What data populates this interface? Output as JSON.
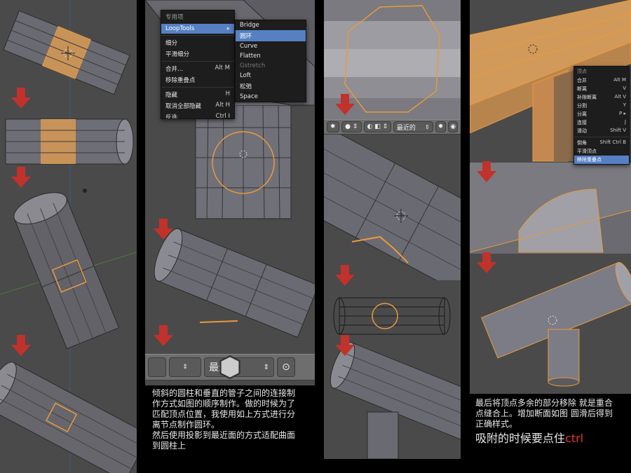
{
  "panel2": {
    "menu_main": {
      "title": "专用项",
      "items": [
        {
          "label": "LoopTools",
          "shortcut": "▸",
          "selected": true
        },
        {
          "label": "细分",
          "shortcut": ""
        },
        {
          "label": "平滑细分",
          "shortcut": ""
        },
        {
          "label": "合并...",
          "shortcut": "Alt M"
        },
        {
          "label": "移除重叠点",
          "shortcut": ""
        },
        {
          "label": "隐藏",
          "shortcut": "H"
        },
        {
          "label": "取消全部隐藏",
          "shortcut": "Alt H"
        },
        {
          "label": "反选",
          "shortcut": "Ctrl I"
        }
      ]
    },
    "menu_sub": {
      "items": [
        {
          "label": "Bridge",
          "state": ""
        },
        {
          "label": "圆环",
          "state": "selected"
        },
        {
          "label": "Curve",
          "state": ""
        },
        {
          "label": "Flatten",
          "state": ""
        },
        {
          "label": "Gstretch",
          "state": "disabled"
        },
        {
          "label": "Loft",
          "state": ""
        },
        {
          "label": "松弛",
          "state": ""
        },
        {
          "label": "Space",
          "state": ""
        }
      ]
    },
    "snap_label": "最近的",
    "caption_lines": [
      "倾斜的圆柱和垂直的管子之间的连接制",
      "作方式如图的顺序制作。做的时候为了",
      "匹配顶点位置，我使用如上方式进行分",
      "离节点制作圆环。",
      "然后使用投影到最近面的方式适配曲面",
      "到圆柱上"
    ]
  },
  "panel3": {
    "snap_label": "最近的"
  },
  "panel4": {
    "menu": {
      "title": "顶点",
      "items": [
        {
          "label": "合并",
          "shortcut": "Alt M",
          "selected": false
        },
        {
          "label": "断离",
          "shortcut": "V",
          "selected": false
        },
        {
          "label": "补隙断离",
          "shortcut": "Alt V",
          "selected": false
        },
        {
          "label": "分割",
          "shortcut": "Y",
          "selected": false
        },
        {
          "label": "分离",
          "shortcut": "P ▸",
          "selected": false
        },
        {
          "label": "连接",
          "shortcut": "J",
          "selected": false
        },
        {
          "label": "滑动",
          "shortcut": "Shift V",
          "selected": false
        },
        {
          "label": "倒角",
          "shortcut": "Shift Ctrl B",
          "selected": false
        },
        {
          "label": "平滑顶点",
          "shortcut": "",
          "selected": false
        },
        {
          "label": "移除重叠点",
          "shortcut": "",
          "selected": true
        }
      ]
    },
    "caption_lines": [
      "最后将顶点多余的部分移除 就是重合",
      "点缝合上。增加断面如图 圆滑后得到",
      "正确样式。"
    ],
    "highlight_text": "吸附的时候要点住",
    "highlight_key": "ctrl"
  },
  "colors": {
    "viewport": "#4a4a4a",
    "selected_orange": "#e89a3c",
    "arrow_red": "#c0322b",
    "menu_highlight": "#5680c2",
    "ctrl_red": "#e03a2f"
  }
}
